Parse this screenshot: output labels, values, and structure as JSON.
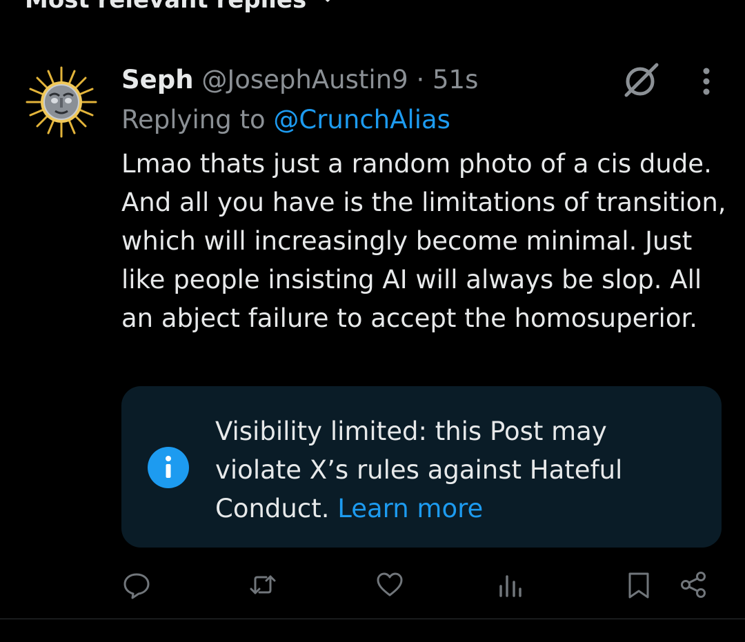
{
  "header": {
    "sort_label": "Most relevant replies",
    "sort_icon": "chevron-down-icon"
  },
  "tweet": {
    "display_name": "Seph",
    "handle": "@JosephAustin9",
    "separator": "·",
    "time": "51s",
    "replying_prefix": "Replying to",
    "replying_to": "@CrunchAlias",
    "body": "Lmao thats just a random photo of a cis dude. And all you have is the limitations of transition, which will increasingly become minimal. Just like people insisting AI will always be slop. All an abject failure to accept the homosuperior.",
    "icons": [
      "avatar-sun-icon",
      "grok-icon",
      "more-options-icon"
    ]
  },
  "notice": {
    "text": "Visibility limited: this Post may violate X’s rules against Hateful Conduct.",
    "link": "Learn more",
    "icon": "info-icon"
  },
  "actions": {
    "icons": [
      "reply-icon",
      "repost-icon",
      "like-icon",
      "views-icon",
      "bookmark-icon",
      "share-icon"
    ]
  },
  "colors": {
    "background": "#000000",
    "text_primary": "#e7e9ea",
    "text_secondary": "#8b9095",
    "accent": "#1d9bf0",
    "notice_background": "#0a1c27",
    "icon_gray": "#71767b"
  }
}
